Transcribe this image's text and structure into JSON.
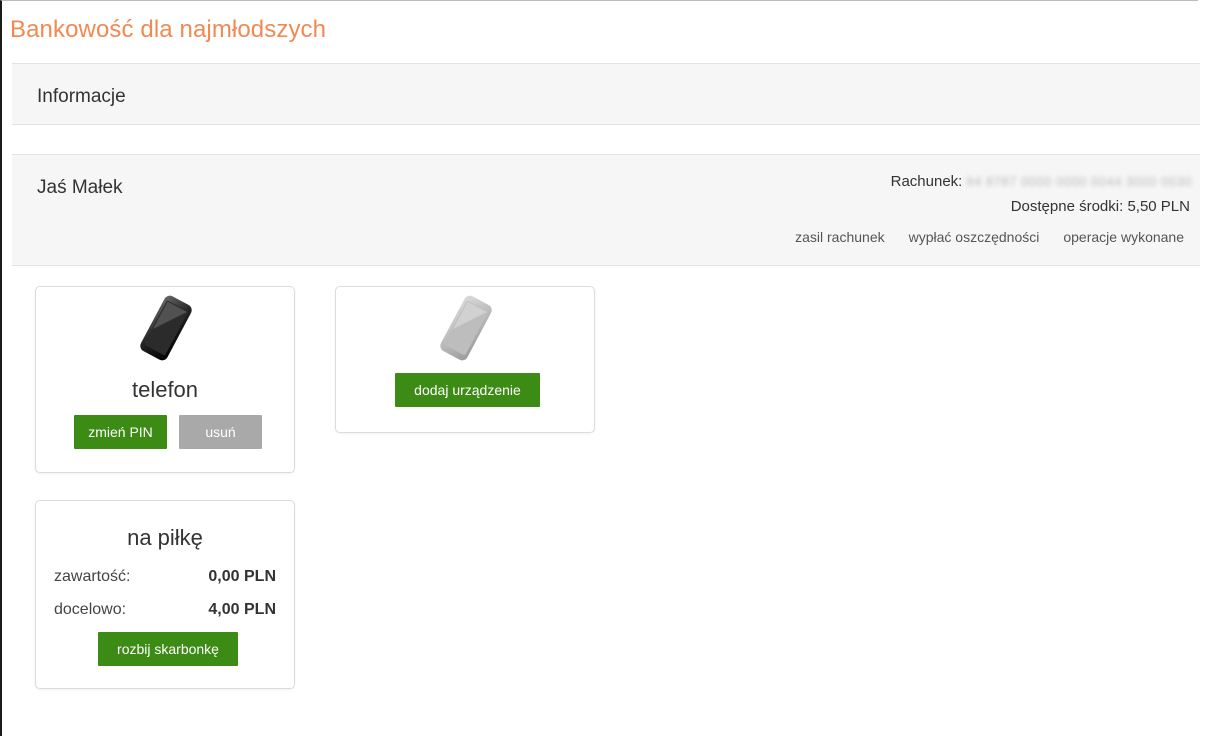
{
  "page": {
    "title": "Bankowość dla najmłodszych"
  },
  "info": {
    "label": "Informacje"
  },
  "child": {
    "name": "Jaś Małek",
    "account_label": "Rachunek:",
    "account_number": "94 8787 0000 0000 0044 3000 0030",
    "funds_text": "Dostępne środki: 5,50 PLN",
    "links": {
      "fund": "zasil rachunek",
      "withdraw": "wypłać oszczędności",
      "operations": "operacje wykonane"
    }
  },
  "devices": {
    "phone": {
      "name": "telefon",
      "change_pin": "zmień PIN",
      "remove": "usuń"
    },
    "add": {
      "label": "dodaj urządzenie"
    }
  },
  "piggy": {
    "title": "na piłkę",
    "content_label": "zawartość:",
    "content_value": "0,00 PLN",
    "target_label": "docelowo:",
    "target_value": "4,00 PLN",
    "break_label": "rozbij skarbonkę"
  },
  "colors": {
    "title_orange": "#f08a52",
    "button_green": "#3c8b14",
    "button_gray": "#a9a9a9"
  }
}
